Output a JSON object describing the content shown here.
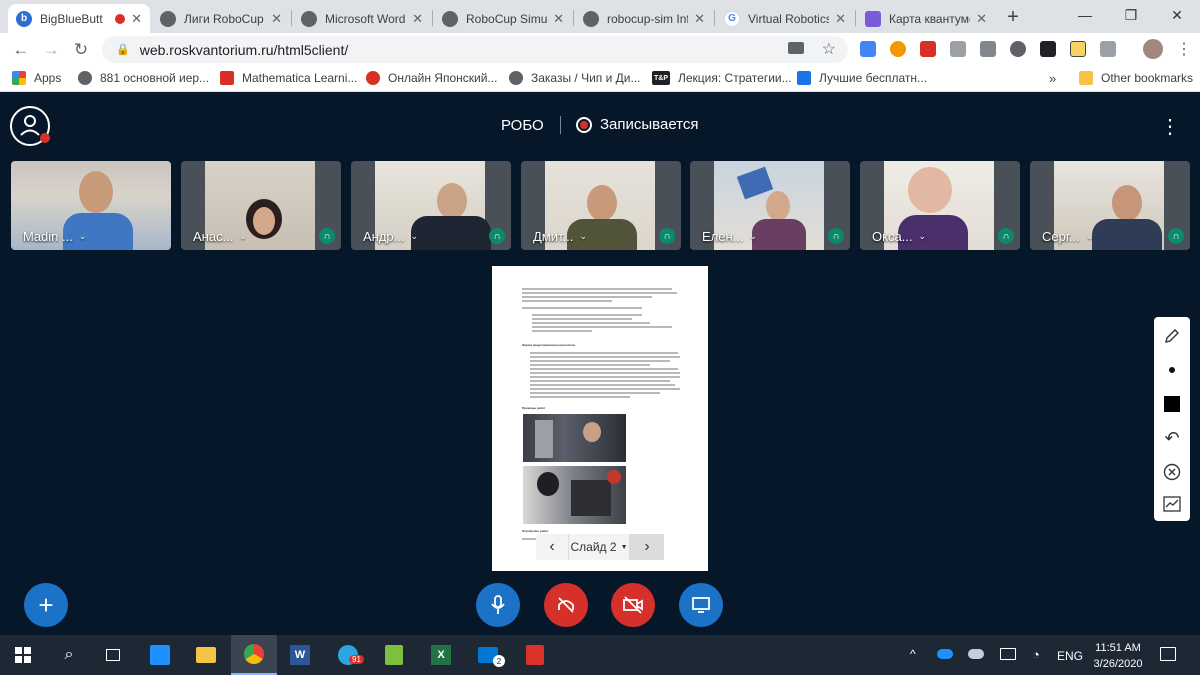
{
  "browser": {
    "tabs": [
      {
        "title": "BigBlueButt",
        "active": true
      },
      {
        "title": "Лиги RoboCup"
      },
      {
        "title": "Microsoft Word"
      },
      {
        "title": "RoboCup Simul"
      },
      {
        "title": "robocup-sim Inf"
      },
      {
        "title": "Virtual Robotics"
      },
      {
        "title": "Карта квантумс"
      }
    ],
    "new_tab": "+",
    "url": "web.roskvantorium.ru/html5client/",
    "bookmarks": [
      {
        "label": "Apps"
      },
      {
        "label": "881 основной иер..."
      },
      {
        "label": "Mathematica Learni..."
      },
      {
        "label": "Онлайн Японский..."
      },
      {
        "label": "Заказы / Чип и Ди..."
      },
      {
        "label": "Лекция: Стратегии..."
      },
      {
        "label": "Лучшие бесплатн..."
      }
    ],
    "bookmarks_more": "»",
    "other_bookmarks": "Other bookmarks"
  },
  "meeting": {
    "title": "РОБО",
    "recording_label": "Записывается"
  },
  "participants": [
    {
      "name": "Madin ...",
      "audio": false
    },
    {
      "name": "Анас...",
      "audio": true
    },
    {
      "name": "Андр...",
      "audio": true
    },
    {
      "name": "Дмит...",
      "audio": true
    },
    {
      "name": "Елен...",
      "audio": true
    },
    {
      "name": "Окса...",
      "audio": true
    },
    {
      "name": "Серг...",
      "audio": true
    }
  ],
  "presentation": {
    "slide_label": "Слайд 2",
    "doc_heading_1": "Форма представления результатов.",
    "doc_heading_2": "Примеры работ",
    "doc_heading_3": "Портфолио работ"
  },
  "taskbar": {
    "time": "11:51 AM",
    "date": "3/26/2020",
    "lang": "ENG",
    "telegram_badge": "91",
    "mail_badge": "2"
  },
  "colors": {
    "app_bg": "#06172a",
    "record_red": "#d93025",
    "action_blue": "#1b72c7",
    "action_red": "#d5302a",
    "audio_green": "#0b8a6b"
  }
}
